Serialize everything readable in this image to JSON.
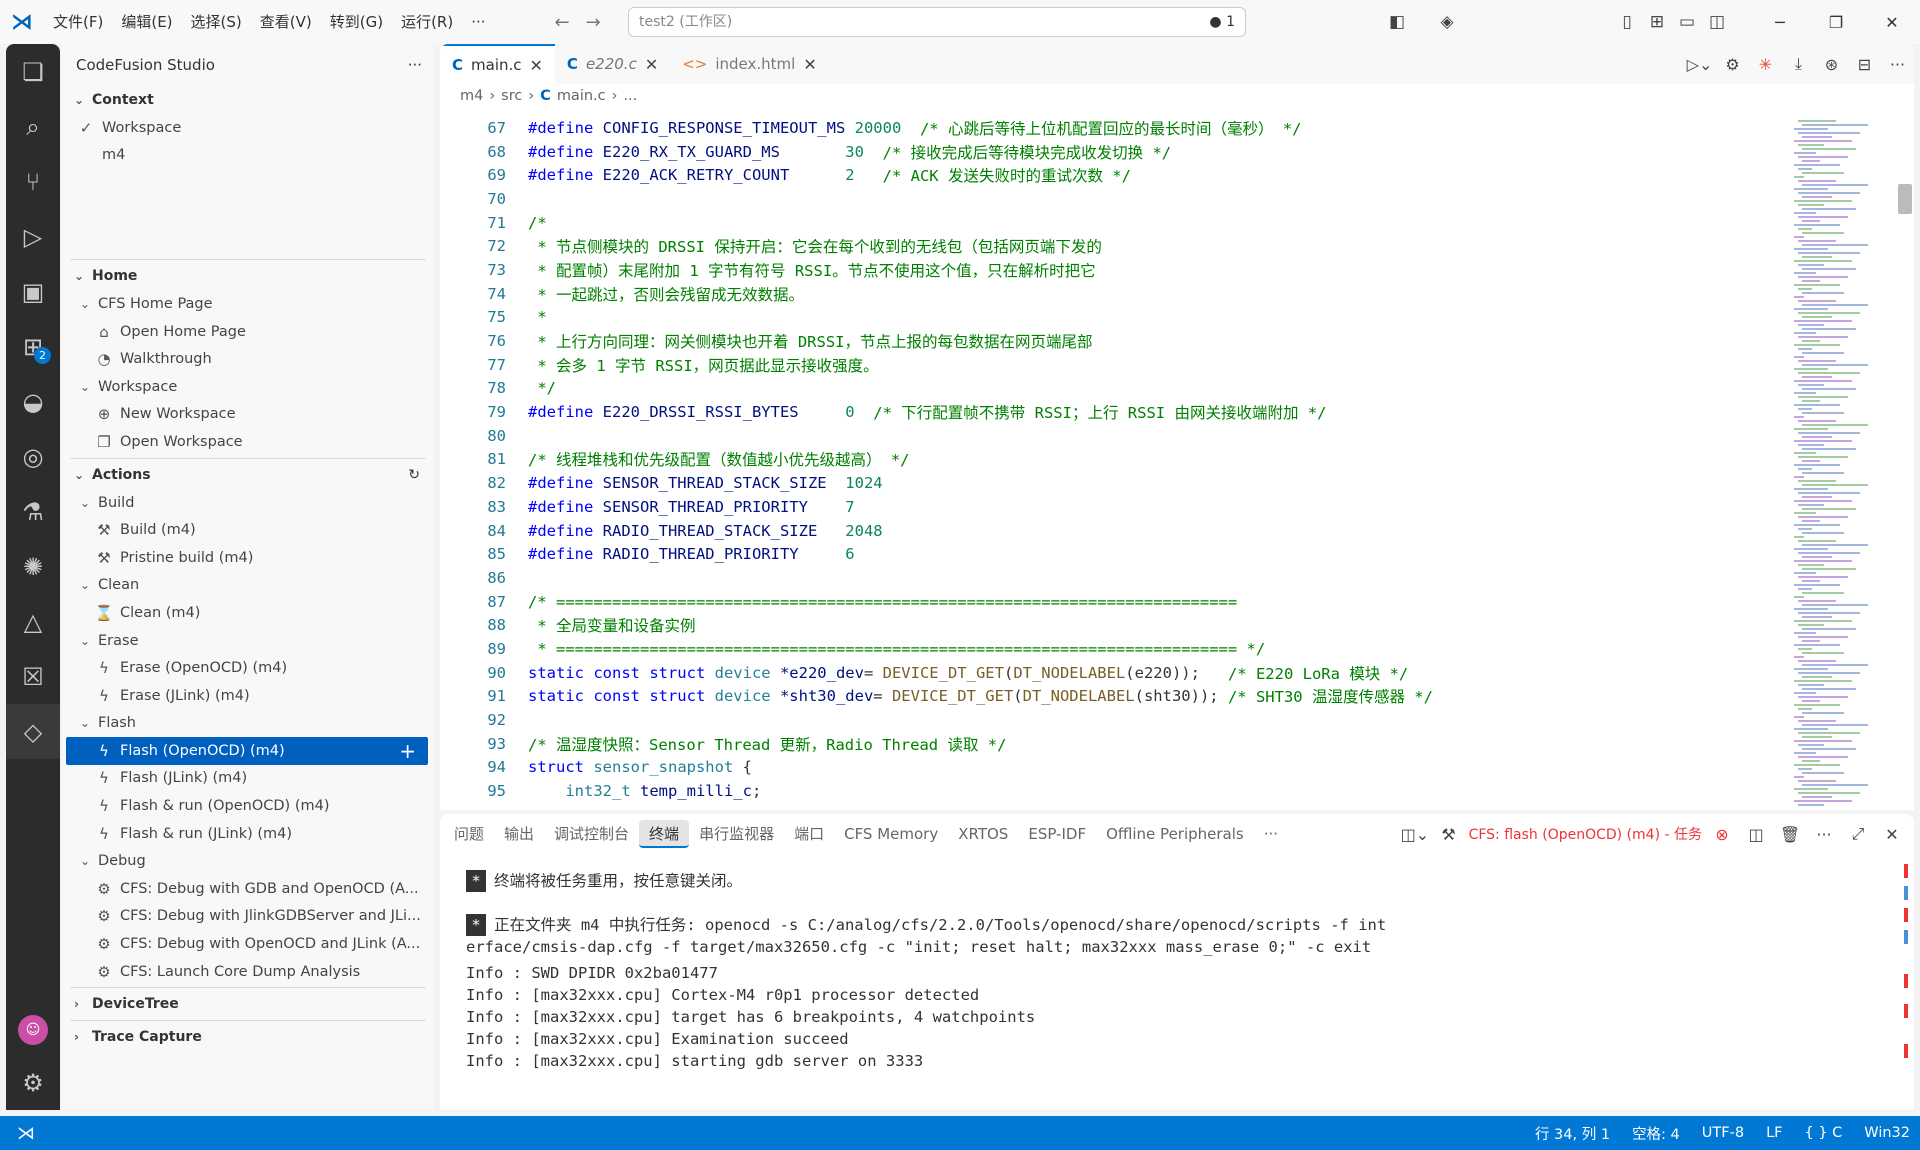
{
  "titlebar": {
    "menus": [
      "文件(F)",
      "编辑(E)",
      "选择(S)",
      "查看(V)",
      "转到(G)",
      "运行(R)",
      "···"
    ],
    "search": "test2 (工作区)",
    "search_right": "● 1"
  },
  "sidebar": {
    "title": "CodeFusion Studio",
    "context_label": "Context",
    "context_items": [
      "Workspace",
      "m4"
    ],
    "home_label": "Home",
    "home": [
      {
        "t": "grp",
        "label": "CFS Home Page"
      },
      {
        "t": "item",
        "icon": "⌂",
        "label": "Open Home Page"
      },
      {
        "t": "item",
        "icon": "◔",
        "label": "Walkthrough"
      },
      {
        "t": "grp",
        "label": "Workspace"
      },
      {
        "t": "item",
        "icon": "⊕",
        "label": "New Workspace"
      },
      {
        "t": "item",
        "icon": "❐",
        "label": "Open Workspace"
      }
    ],
    "actions_label": "Actions",
    "actions": [
      {
        "t": "grp",
        "label": "Build"
      },
      {
        "t": "item",
        "icon": "⚒",
        "label": "Build (m4)"
      },
      {
        "t": "item",
        "icon": "⚒",
        "label": "Pristine build (m4)"
      },
      {
        "t": "grp",
        "label": "Clean"
      },
      {
        "t": "item",
        "icon": "⌛",
        "label": "Clean (m4)"
      },
      {
        "t": "grp",
        "label": "Erase"
      },
      {
        "t": "item",
        "icon": "ϟ",
        "label": "Erase (OpenOCD) (m4)"
      },
      {
        "t": "item",
        "icon": "ϟ",
        "label": "Erase (JLink) (m4)"
      },
      {
        "t": "grp",
        "label": "Flash"
      },
      {
        "t": "item",
        "icon": "ϟ",
        "label": "Flash (OpenOCD) (m4)",
        "sel": true
      },
      {
        "t": "item",
        "icon": "ϟ",
        "label": "Flash (JLink) (m4)"
      },
      {
        "t": "item",
        "icon": "ϟ",
        "label": "Flash & run (OpenOCD) (m4)"
      },
      {
        "t": "item",
        "icon": "ϟ",
        "label": "Flash & run (JLink) (m4)"
      },
      {
        "t": "grp",
        "label": "Debug"
      },
      {
        "t": "item",
        "icon": "⚙",
        "label": "CFS: Debug with GDB and OpenOCD (A..."
      },
      {
        "t": "item",
        "icon": "⚙",
        "label": "CFS: Debug with JlinkGDBServer and JLi..."
      },
      {
        "t": "item",
        "icon": "⚙",
        "label": "CFS: Debug with OpenOCD and JLink (A..."
      },
      {
        "t": "item",
        "icon": "⚙",
        "label": "CFS: Launch Core Dump Analysis"
      }
    ],
    "devicetree_label": "DeviceTree",
    "trace_label": "Trace Capture"
  },
  "editor": {
    "tabs": [
      {
        "label": "main.c",
        "type": "c",
        "active": true
      },
      {
        "label": "e220.c",
        "type": "c"
      },
      {
        "label": "index.html",
        "type": "h"
      }
    ],
    "breadcrumb": [
      "m4",
      "src",
      "main.c",
      "..."
    ],
    "lines": [
      {
        "n": "67",
        "s": [
          [
            "mac",
            "#define "
          ],
          [
            "var",
            "CONFIG_RESPONSE_TIMEOUT_MS "
          ],
          [
            "num",
            "20000"
          ],
          [
            "cm",
            "  /* 心跳后等待上位机配置回应的最长时间（毫秒） */"
          ]
        ]
      },
      {
        "n": "68",
        "s": [
          [
            "mac",
            "#define "
          ],
          [
            "var",
            "E220_RX_TX_GUARD_MS       "
          ],
          [
            "num",
            "30"
          ],
          [
            "cm",
            "  /* 接收完成后等待模块完成收发切换 */"
          ]
        ]
      },
      {
        "n": "69",
        "s": [
          [
            "mac",
            "#define "
          ],
          [
            "var",
            "E220_ACK_RETRY_COUNT      "
          ],
          [
            "num",
            "2"
          ],
          [
            "cm",
            "   /* ACK 发送失败时的重试次数 */"
          ]
        ]
      },
      {
        "n": "70",
        "s": []
      },
      {
        "n": "71",
        "s": [
          [
            "cm",
            "/*"
          ]
        ]
      },
      {
        "n": "72",
        "s": [
          [
            "cm",
            " * 节点侧模块的 DRSSI 保持开启：它会在每个收到的无线包（包括网页端下发的"
          ]
        ]
      },
      {
        "n": "73",
        "s": [
          [
            "cm",
            " * 配置帧）末尾附加 1 字节有符号 RSSI。节点不使用这个值，只在解析时把它"
          ]
        ]
      },
      {
        "n": "74",
        "s": [
          [
            "cm",
            " * 一起跳过，否则会残留成无效数据。"
          ]
        ]
      },
      {
        "n": "75",
        "s": [
          [
            "cm",
            " *"
          ]
        ]
      },
      {
        "n": "76",
        "s": [
          [
            "cm",
            " * 上行方向同理：网关侧模块也开着 DRSSI，节点上报的每包数据在网页端尾部"
          ]
        ]
      },
      {
        "n": "77",
        "s": [
          [
            "cm",
            " * 会多 1 字节 RSSI，网页据此显示接收强度。"
          ]
        ]
      },
      {
        "n": "78",
        "s": [
          [
            "cm",
            " */"
          ]
        ]
      },
      {
        "n": "79",
        "s": [
          [
            "mac",
            "#define "
          ],
          [
            "var",
            "E220_DRSSI_RSSI_BYTES     "
          ],
          [
            "num",
            "0"
          ],
          [
            "cm",
            "  /* 下行配置帧不携带 RSSI；上行 RSSI 由网关接收端附加 */"
          ]
        ]
      },
      {
        "n": "80",
        "s": []
      },
      {
        "n": "81",
        "s": [
          [
            "cm",
            "/* 线程堆栈和优先级配置（数值越小优先级越高） */"
          ]
        ]
      },
      {
        "n": "82",
        "s": [
          [
            "mac",
            "#define "
          ],
          [
            "var",
            "SENSOR_THREAD_STACK_SIZE  "
          ],
          [
            "num",
            "1024"
          ]
        ]
      },
      {
        "n": "83",
        "s": [
          [
            "mac",
            "#define "
          ],
          [
            "var",
            "SENSOR_THREAD_PRIORITY    "
          ],
          [
            "num",
            "7"
          ]
        ]
      },
      {
        "n": "84",
        "s": [
          [
            "mac",
            "#define "
          ],
          [
            "var",
            "RADIO_THREAD_STACK_SIZE   "
          ],
          [
            "num",
            "2048"
          ]
        ]
      },
      {
        "n": "85",
        "s": [
          [
            "mac",
            "#define "
          ],
          [
            "var",
            "RADIO_THREAD_PRIORITY     "
          ],
          [
            "num",
            "6"
          ]
        ]
      },
      {
        "n": "86",
        "s": []
      },
      {
        "n": "87",
        "s": [
          [
            "cm",
            "/* ========================================================================="
          ]
        ]
      },
      {
        "n": "88",
        "s": [
          [
            "cm",
            " * 全局变量和设备实例"
          ]
        ]
      },
      {
        "n": "89",
        "s": [
          [
            "cm",
            " * ========================================================================= */"
          ]
        ]
      },
      {
        "n": "90",
        "s": [
          [
            "tp",
            "static const struct "
          ],
          [
            "st",
            "device "
          ],
          [
            "var",
            "*e220_dev"
          ],
          [
            "",
            "= "
          ],
          [
            "fn",
            "DEVICE_DT_GET"
          ],
          [
            "",
            "("
          ],
          [
            "fn",
            "DT_NODELABEL"
          ],
          [
            "",
            "(e220));   "
          ],
          [
            "cm",
            "/* E220 LoRa 模块 */"
          ]
        ]
      },
      {
        "n": "91",
        "s": [
          [
            "tp",
            "static const struct "
          ],
          [
            "st",
            "device "
          ],
          [
            "var",
            "*sht30_dev"
          ],
          [
            "",
            "= "
          ],
          [
            "fn",
            "DEVICE_DT_GET"
          ],
          [
            "",
            "("
          ],
          [
            "fn",
            "DT_NODELABEL"
          ],
          [
            "",
            "(sht30)); "
          ],
          [
            "cm",
            "/* SHT30 温湿度传感器 */"
          ]
        ]
      },
      {
        "n": "92",
        "s": []
      },
      {
        "n": "93",
        "s": [
          [
            "cm",
            "/* 温湿度快照：Sensor Thread 更新，Radio Thread 读取 */"
          ]
        ]
      },
      {
        "n": "94",
        "s": [
          [
            "tp",
            "struct "
          ],
          [
            "st",
            "sensor_snapshot "
          ],
          [
            "",
            "{"
          ]
        ]
      },
      {
        "n": "95",
        "s": [
          [
            "",
            "    "
          ],
          [
            "st",
            "int32_t "
          ],
          [
            "var",
            "temp_milli_c"
          ],
          [
            "",
            ";"
          ]
        ]
      }
    ]
  },
  "panel": {
    "tabs": [
      "问题",
      "输出",
      "调试控制台",
      "终端",
      "串行监视器",
      "端口",
      "CFS Memory",
      "XRTOS",
      "ESP-IDF",
      "Offline Peripherals",
      "···"
    ],
    "active_tab": 3,
    "task": "CFS: flash (OpenOCD) (m4) - 任务",
    "lines": [
      {
        "star": true,
        "text": "终端将被任务重用，按任意键关闭。"
      },
      {
        "text": ""
      },
      {
        "star": true,
        "text": "正在文件夹 m4 中执行任务: openocd -s C:/analog/cfs/2.2.0/Tools/openocd/share/openocd/scripts -f int"
      },
      {
        "text": "erface/cmsis-dap.cfg -f target/max32650.cfg -c \"init; reset halt; max32xxx mass_erase 0;\" -c exit"
      },
      {
        "text": "Info : SWD DPIDR 0x2ba01477"
      },
      {
        "text": "Info : [max32xxx.cpu] Cortex-M4 r0p1 processor detected"
      },
      {
        "text": "Info : [max32xxx.cpu] target has 6 breakpoints, 4 watchpoints"
      },
      {
        "text": "Info : [max32xxx.cpu] Examination succeed"
      },
      {
        "text": "Info : [max32xxx.cpu] starting gdb server on 3333"
      }
    ]
  },
  "statusbar": {
    "pos": "行 34, 列 1",
    "spaces": "空格: 4",
    "enc": "UTF-8",
    "eol": "LF",
    "lang": "{ } C",
    "plat": "Win32"
  }
}
